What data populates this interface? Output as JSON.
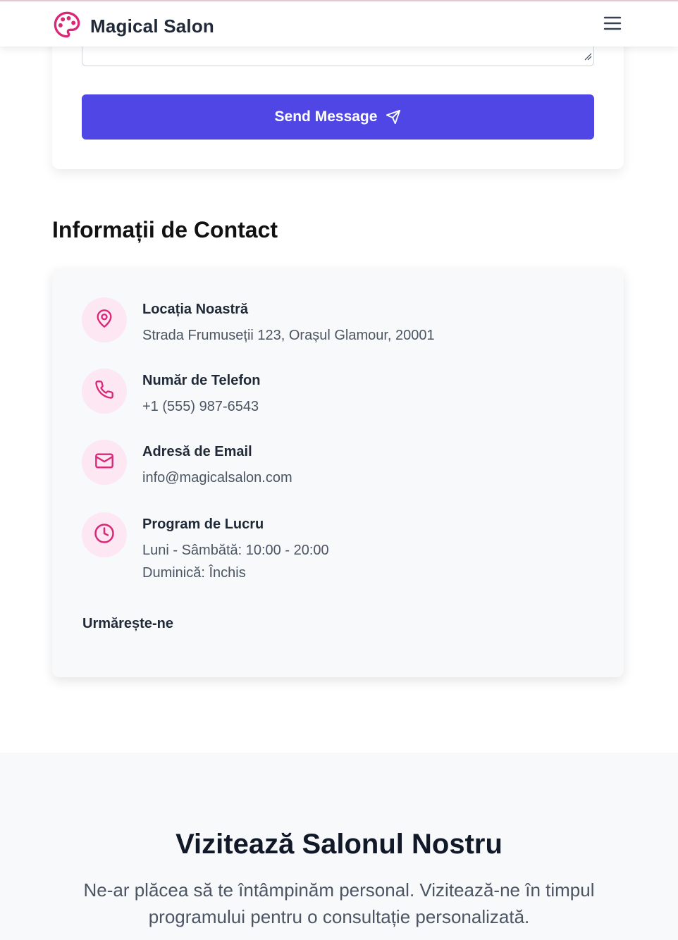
{
  "header": {
    "brand": "Magical Salon",
    "brand_color": "#db2777",
    "logo_icon": "palette-icon",
    "menu_icon": "hamburger-menu-icon"
  },
  "form": {
    "send_label": "Send Message",
    "send_icon": "send-icon",
    "button_color": "#4f46e5"
  },
  "contact": {
    "title": "Informații de Contact",
    "accent_color": "#db2777",
    "icon_bg": "#fce7f3",
    "items": [
      {
        "icon": "map-pin-icon",
        "label": "Locația Noastră",
        "lines": [
          "Strada Frumuseții 123, Orașul Glamour, 20001"
        ]
      },
      {
        "icon": "phone-icon",
        "label": "Număr de Telefon",
        "lines": [
          "+1 (555) 987-6543"
        ]
      },
      {
        "icon": "mail-icon",
        "label": "Adresă de Email",
        "lines": [
          "info@magicalsalon.com"
        ]
      },
      {
        "icon": "clock-icon",
        "label": "Program de Lucru",
        "lines": [
          "Luni - Sâmbătă: 10:00 - 20:00",
          "Duminică: Închis"
        ]
      }
    ],
    "follow_label": "Urmărește-ne"
  },
  "visit": {
    "title": "Vizitează Salonul Nostru",
    "text": "Ne-ar plăcea să te întâmpinăm personal. Vizitează-ne în timpul programului pentru o consultație personalizată."
  }
}
